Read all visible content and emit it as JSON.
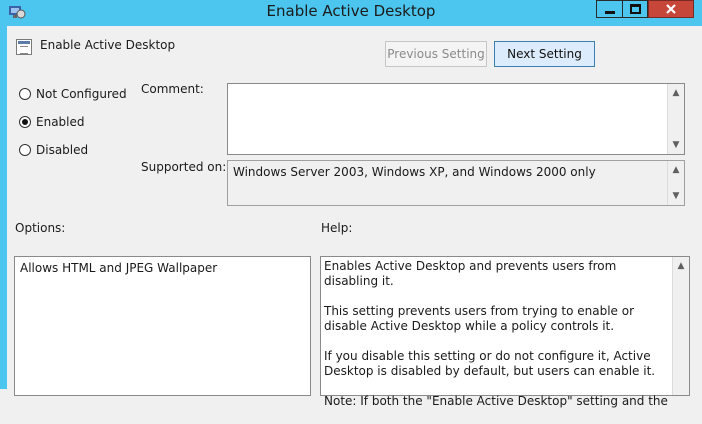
{
  "window": {
    "title": "Enable Active Desktop",
    "controls": {
      "minimize": "minimize",
      "maximize": "maximize",
      "close": "close"
    }
  },
  "header": {
    "policy_name": "Enable Active Desktop",
    "prev_button": "Previous Setting",
    "next_button": "Next Setting"
  },
  "state": {
    "options": [
      {
        "label": "Not Configured",
        "checked": false
      },
      {
        "label": "Enabled",
        "checked": true
      },
      {
        "label": "Disabled",
        "checked": false
      }
    ]
  },
  "comment": {
    "label": "Comment:",
    "value": ""
  },
  "supported": {
    "label": "Supported on:",
    "value": "Windows Server 2003, Windows XP, and Windows 2000 only"
  },
  "options_panel": {
    "label": "Options:",
    "value": "Allows HTML and JPEG Wallpaper"
  },
  "help_panel": {
    "label": "Help:",
    "paragraphs": [
      "Enables Active Desktop and prevents users from disabling it.",
      "This setting prevents users from trying to enable or disable Active Desktop while a policy controls it.",
      "If you disable this setting or do not configure it, Active Desktop is disabled by default, but users can enable it.",
      "Note: If both the \"Enable Active Desktop\" setting and the"
    ]
  },
  "colors": {
    "titlebar": "#4cc6ef",
    "close_button": "#c7463a",
    "window_bg": "#f0f0f0"
  }
}
